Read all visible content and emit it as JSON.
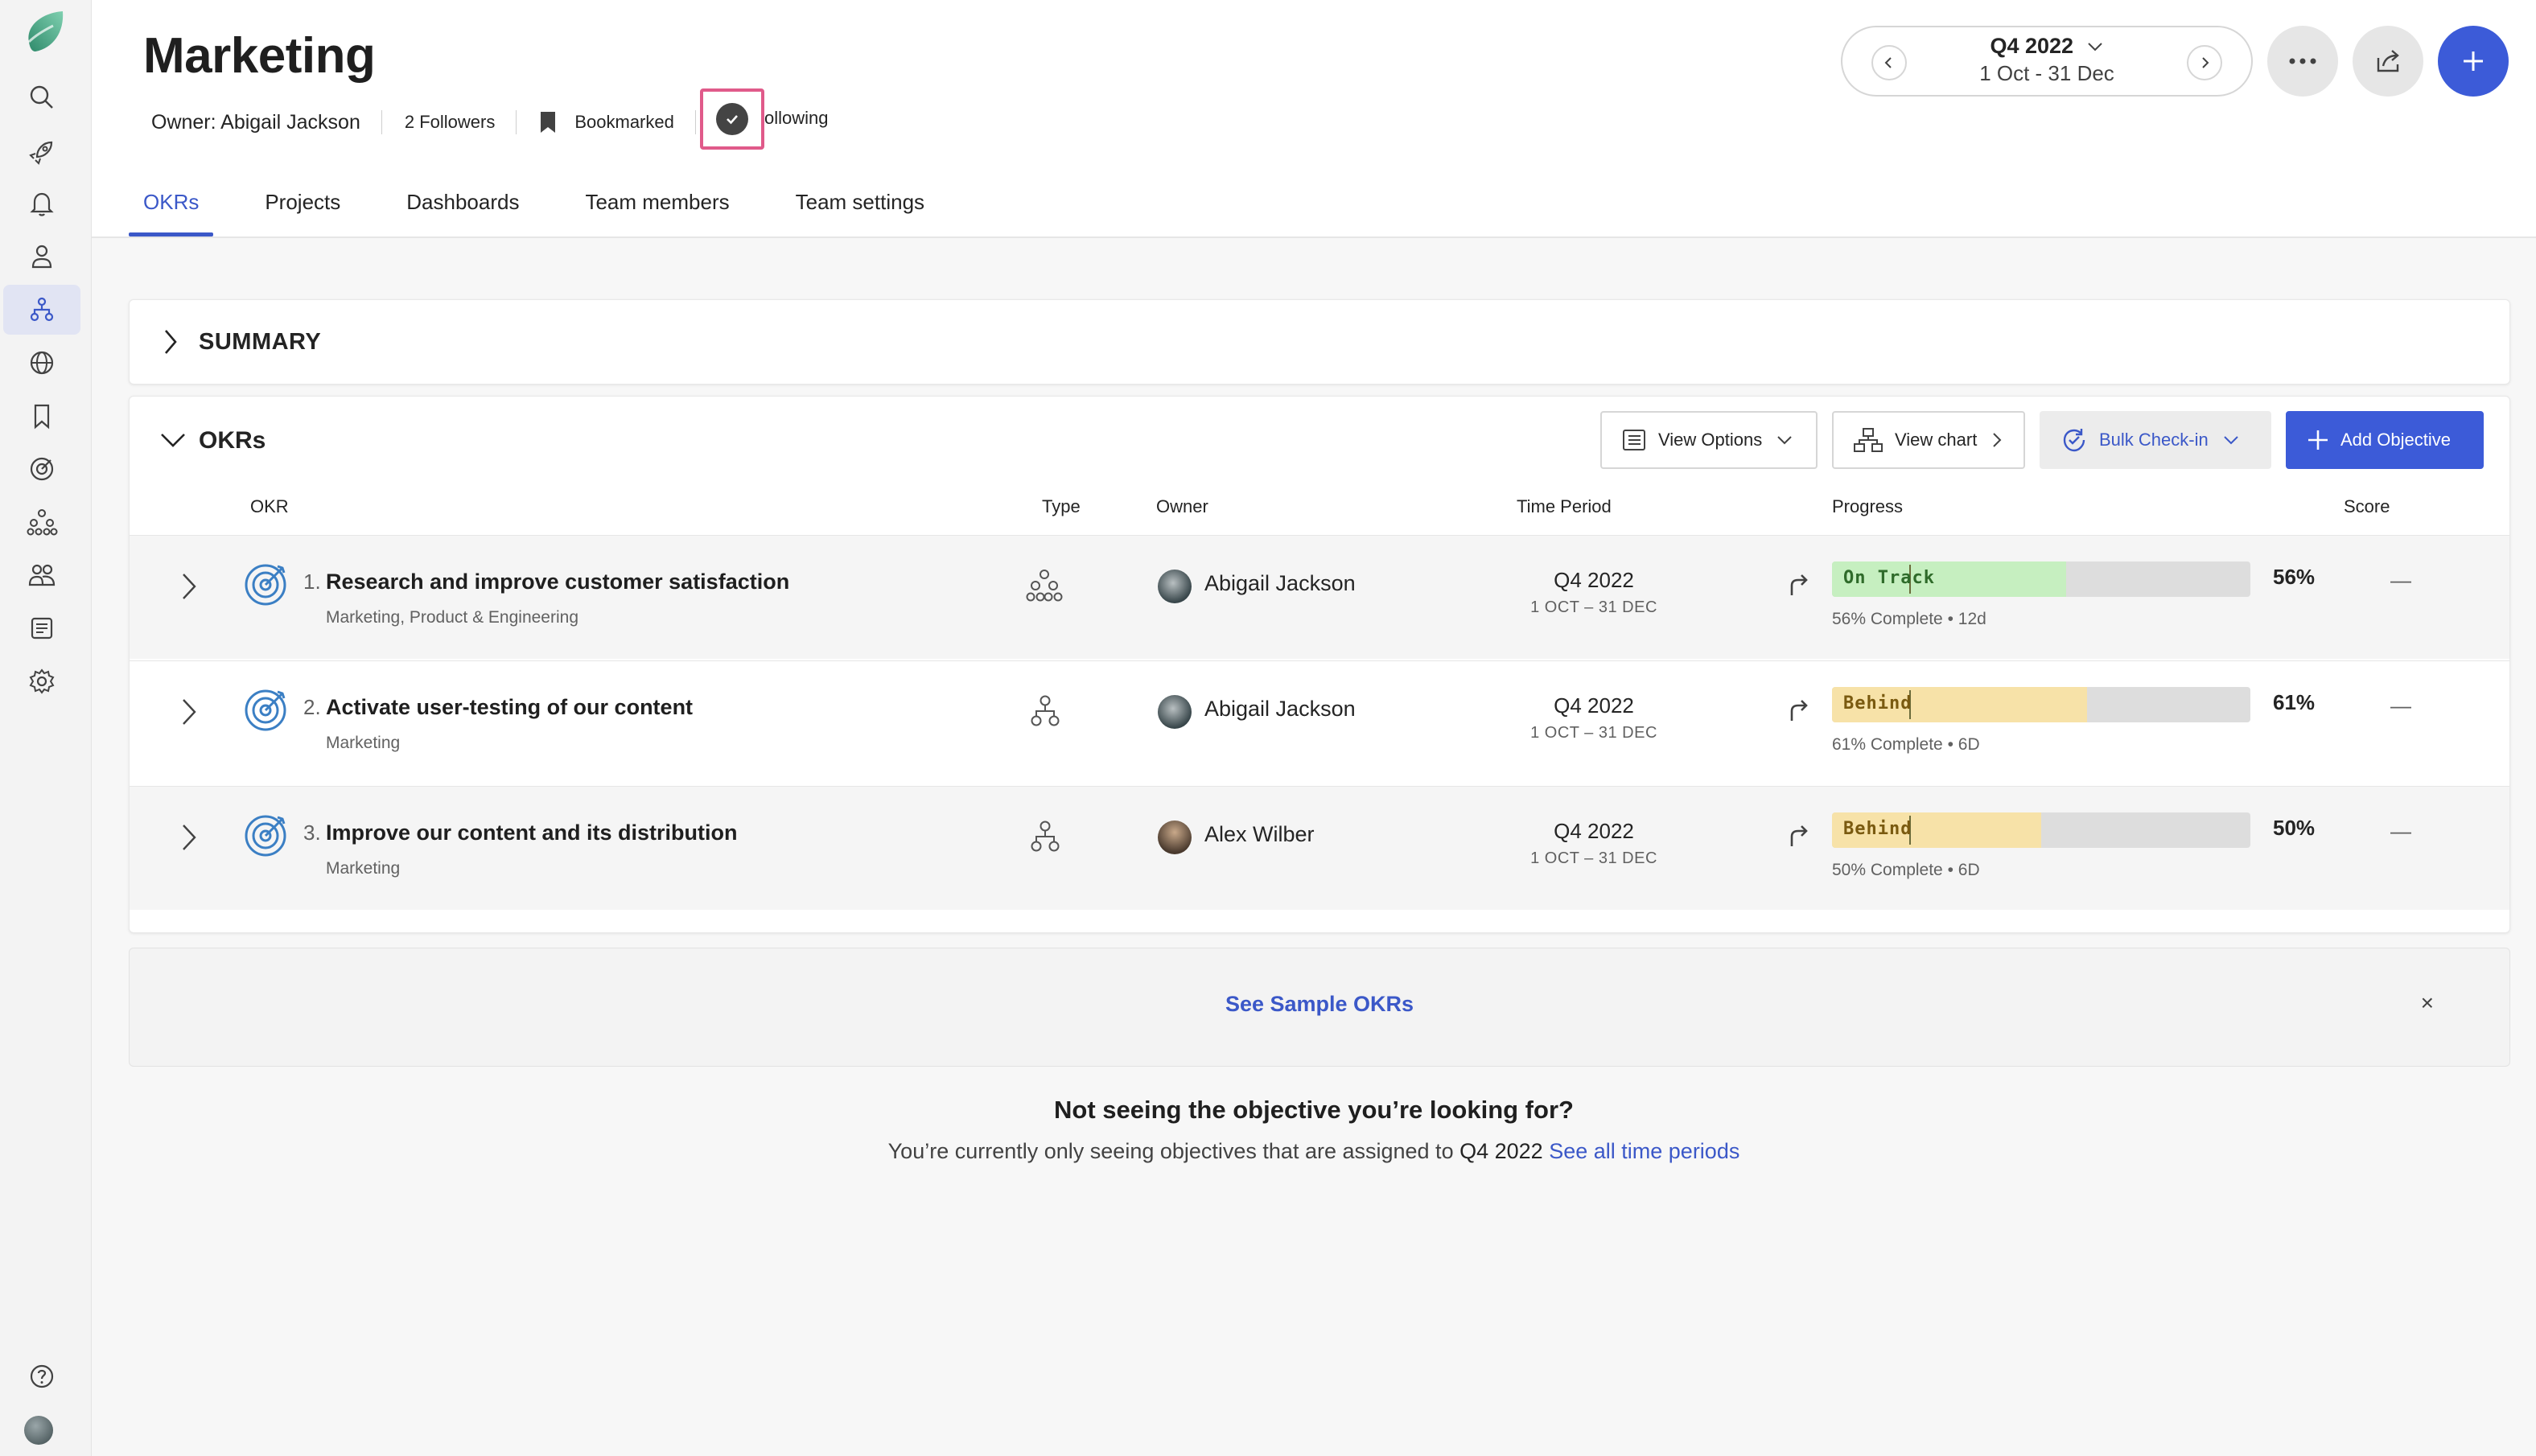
{
  "header": {
    "title": "Marketing",
    "owner": "Owner: Abigail Jackson",
    "followers": "2 Followers",
    "bookmarked": "Bookmarked",
    "following": "ollowing"
  },
  "period": {
    "label": "Q4 2022",
    "range": "1 Oct - 31 Dec"
  },
  "tabs": [
    {
      "label": "OKRs",
      "active": true
    },
    {
      "label": "Projects"
    },
    {
      "label": "Dashboards"
    },
    {
      "label": "Team members"
    },
    {
      "label": "Team settings"
    }
  ],
  "summary": {
    "title": "SUMMARY"
  },
  "okrs": {
    "title": "OKRs",
    "toolbar": {
      "view_options": "View Options",
      "view_chart": "View chart",
      "bulk_checkin": "Bulk Check-in",
      "add_objective": "Add Objective"
    },
    "columns": [
      "OKR",
      "Type",
      "Owner",
      "Time Period",
      "Progress",
      "Score"
    ],
    "rows": [
      {
        "index": "1.",
        "name": "Research and improve customer satisfaction",
        "teams": "Marketing, Product & Engineering",
        "owner": "Abigail Jackson",
        "period": "Q4 2022",
        "period_range": "1 OCT – 31 DEC",
        "status": "On Track",
        "status_color": "#c6efc0",
        "progress": 0.56,
        "pct": "56%",
        "note": "56% Complete • 12d",
        "score": "—"
      },
      {
        "index": "2.",
        "name": "Activate user-testing of our content",
        "teams": "Marketing",
        "owner": "Abigail Jackson",
        "period": "Q4 2022",
        "period_range": "1 OCT – 31 DEC",
        "status": "Behind",
        "status_color": "#f7e2a8",
        "progress": 0.61,
        "pct": "61%",
        "note": "61% Complete • 6D",
        "score": "—"
      },
      {
        "index": "3.",
        "name": "Improve our content and its distribution",
        "teams": "Marketing",
        "owner": "Alex Wilber",
        "period": "Q4 2022",
        "period_range": "1 OCT – 31 DEC",
        "status": "Behind",
        "status_color": "#f7e2a8",
        "progress": 0.5,
        "pct": "50%",
        "note": "50% Complete • 6D",
        "score": "—"
      }
    ]
  },
  "sample": {
    "link": "See Sample OKRs",
    "close": "×"
  },
  "footer": {
    "title": "Not seeing the objective you’re looking for?",
    "text": "You’re currently only seeing objectives that are assigned to",
    "period": "Q4 2022",
    "link": "See all time periods"
  },
  "colors": {
    "accent": "#3c5bd8",
    "highlight": "#e05a8a"
  }
}
